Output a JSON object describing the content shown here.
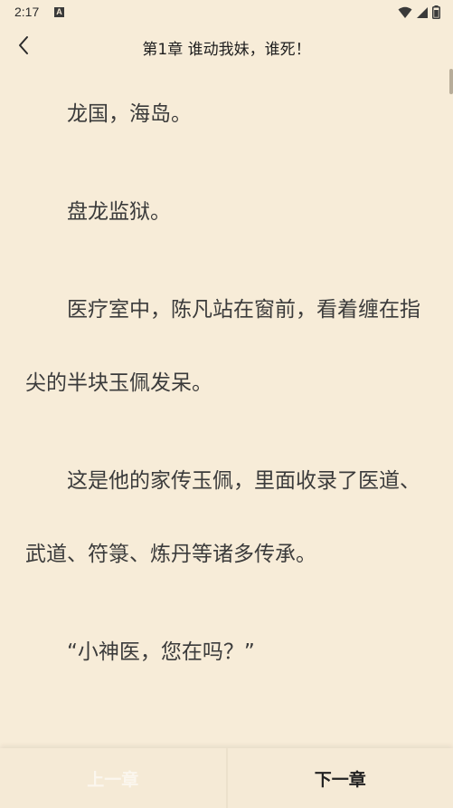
{
  "status_bar": {
    "time": "2:17",
    "a_badge": "A",
    "icons": [
      "wifi-icon",
      "signal-icon",
      "battery-icon"
    ]
  },
  "header": {
    "title": "第1章 谁动我妹，谁死！",
    "back_icon": "chevron-left-icon"
  },
  "content": {
    "paragraphs": [
      "龙国，海岛。",
      "盘龙监狱。",
      "医疗室中，陈凡站在窗前，看着缠在指尖的半块玉佩发呆。",
      "这是他的家传玉佩，里面收录了医道、武道、符箓、炼丹等诸多传承。",
      "“小神医，您在吗？”"
    ]
  },
  "footer": {
    "prev_label": "上一章",
    "next_label": "下一章"
  },
  "colors": {
    "background": "#f7ecd8",
    "text": "#3b3b3b",
    "prev_disabled": "#fbf6ee"
  }
}
